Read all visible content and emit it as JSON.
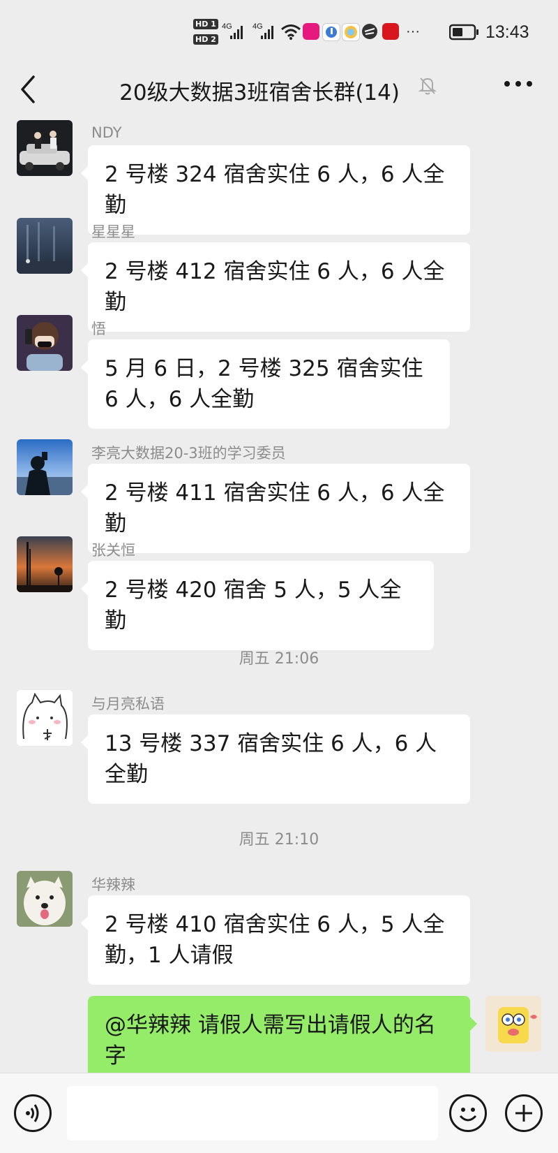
{
  "status_bar": {
    "sim1": "HD 1",
    "sim2": "HD 2",
    "net1": "4G",
    "net2": "4G",
    "more": "···",
    "time": "13:43"
  },
  "header": {
    "title": "20级大数据3班宿舍长群(14)",
    "back_icon": "chevron-left-icon",
    "mute_icon": "bell-off-icon",
    "more_icon": "more-dots-icon"
  },
  "messages": [
    {
      "sender": "NDY",
      "text": "2 号楼 324 宿舍实住 6 人，6 人全勤"
    },
    {
      "sender": "星星星",
      "text": "2 号楼 412 宿舍实住 6 人，6 人全勤"
    },
    {
      "sender": "悟",
      "text": "5 月 6 日，2 号楼 325 宿舍实住 6 人，6 人全勤"
    },
    {
      "sender": "李亮大数据20-3班的学习委员",
      "text": "2 号楼 411 宿舍实住 6 人，6 人全勤"
    },
    {
      "sender": "张关恒",
      "text": "2 号楼 420 宿舍 5 人，5 人全勤"
    },
    {
      "sender": "与月亮私语",
      "text": "13 号楼 337 宿舍实住 6 人，6 人全勤"
    },
    {
      "sender": "华辣辣",
      "text": "2 号楼 410 宿舍实住 6 人，5 人全勤，1 人请假"
    },
    {
      "sender": "",
      "text": "@华辣辣  请假人需写出请假人的名字"
    }
  ],
  "timestamps": [
    "周五 21:06",
    "周五 21:10"
  ],
  "input_bar": {
    "voice_icon": "voice-icon",
    "emoji_icon": "emoji-icon",
    "plus_icon": "plus-icon",
    "placeholder": ""
  },
  "colors": {
    "background": "#ededed",
    "bubble_other": "#ffffff",
    "bubble_self": "#95ec69",
    "meta_text": "#8c8c8c"
  }
}
